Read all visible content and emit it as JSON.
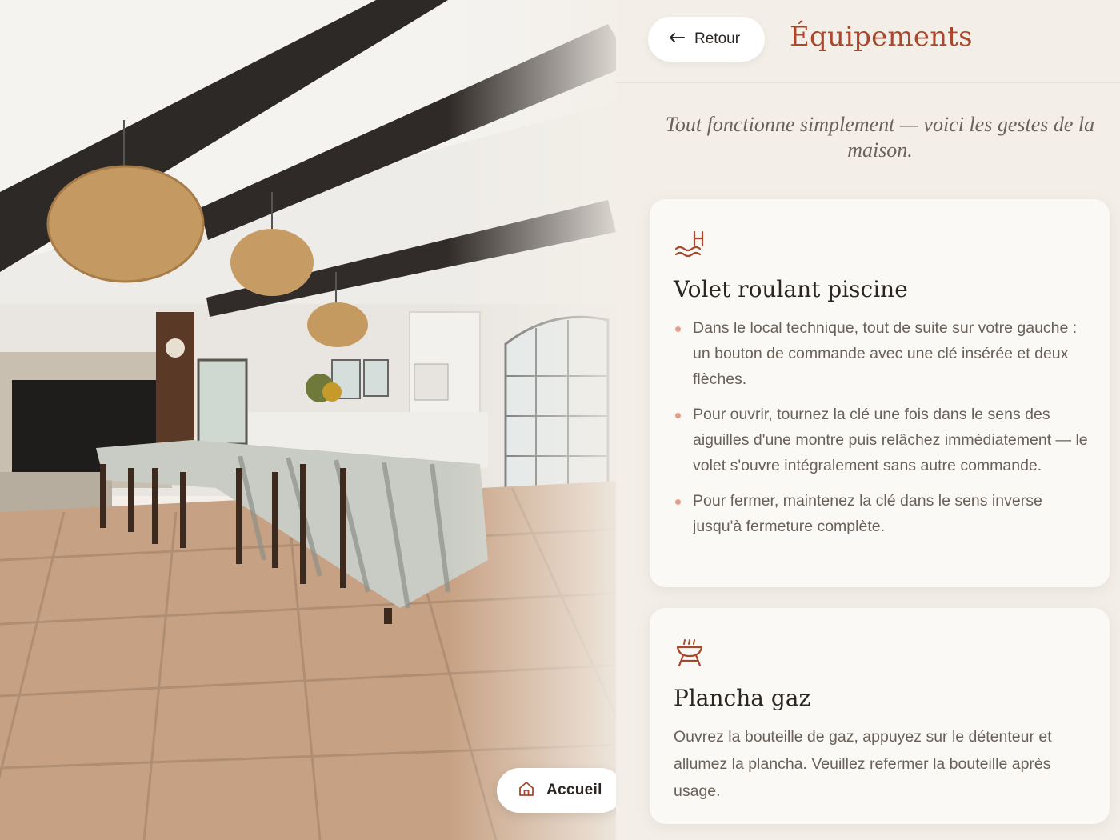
{
  "photo": {
    "alt": ""
  },
  "home_button": {
    "label": "Accueil",
    "icon": "home-icon"
  },
  "header": {
    "back_label": "Retour",
    "back_icon": "arrow-left-icon",
    "title": "Équipements"
  },
  "intro": "Tout fonctionne simplement — voici les gestes de la maison.",
  "cards": [
    {
      "icon": "pool-icon",
      "title": "Volet roulant piscine",
      "bullets": [
        "Dans le local technique, tout de suite sur votre gauche : un bouton de commande avec une clé insérée et deux flèches.",
        "Pour ouvrir, tournez la clé une fois dans le sens des aiguilles d'une montre puis relâchez immédiatement — le volet s'ouvre intégralement sans autre commande.",
        "Pour fermer, maintenez la clé dans le sens inverse jusqu'à fermeture complète."
      ]
    },
    {
      "icon": "grill-icon",
      "title": "Plancha gaz",
      "text": "Ouvrez la bouteille de gaz, appuyez sur le détenteur et allumez la plancha. Veuillez refermer la bouteille après usage."
    }
  ],
  "colors": {
    "accent": "#a9482d",
    "background": "#f3efe8",
    "card": "#fbf9f5",
    "bullet": "#e0a08d"
  }
}
